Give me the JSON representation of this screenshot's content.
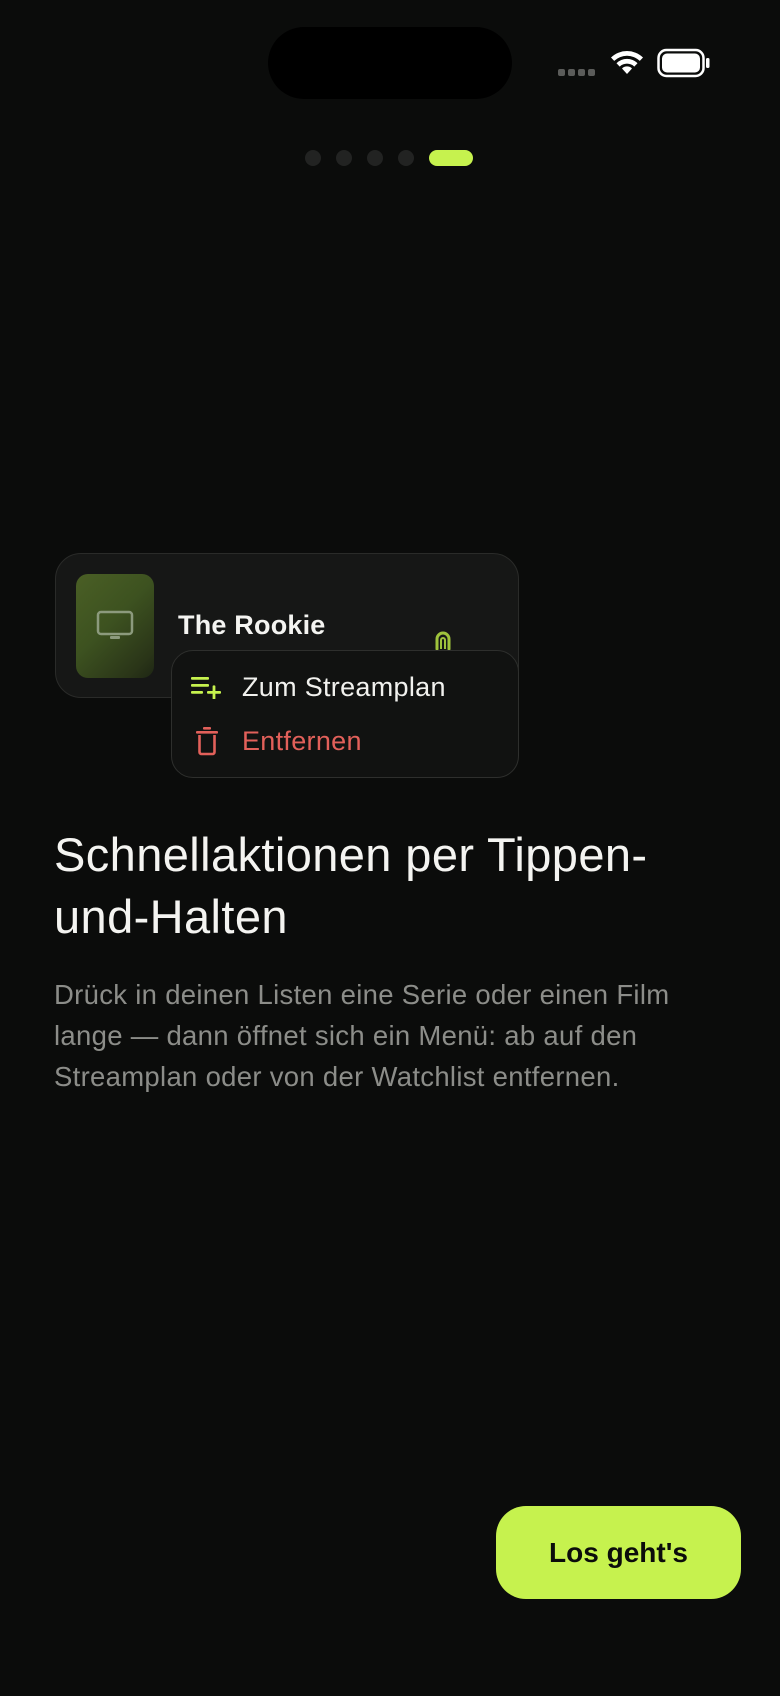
{
  "status_bar": {
    "wifi_icon": "wifi-icon",
    "battery_icon": "battery-full-icon"
  },
  "onboarding": {
    "page_count": 5,
    "active_page_index": 5
  },
  "preview_card": {
    "title": "The Rookie",
    "poster_icon": "tv-icon",
    "handle_icon": "drag-handle-icon"
  },
  "context_menu": {
    "items": [
      {
        "label": "Zum Streamplan",
        "icon": "playlist-add-icon",
        "color": "#c6f24e"
      },
      {
        "label": "Entfernen",
        "icon": "trash-icon",
        "color": "#e2605a"
      }
    ]
  },
  "content": {
    "headline": "Schnellaktionen per Tippen-und-Halten",
    "description": "Drück in deinen Listen eine Serie oder einen Film lange — dann öffnet sich ein Menü: ab auf den Streamplan oder von der Watchlist entfernen."
  },
  "cta": {
    "label": "Los geht's"
  },
  "colors": {
    "background": "#0b0c0b",
    "accent": "#c6f24e",
    "destructive": "#e2605a",
    "text_primary": "#f4f4f1",
    "text_secondary": "#8c8d89"
  }
}
